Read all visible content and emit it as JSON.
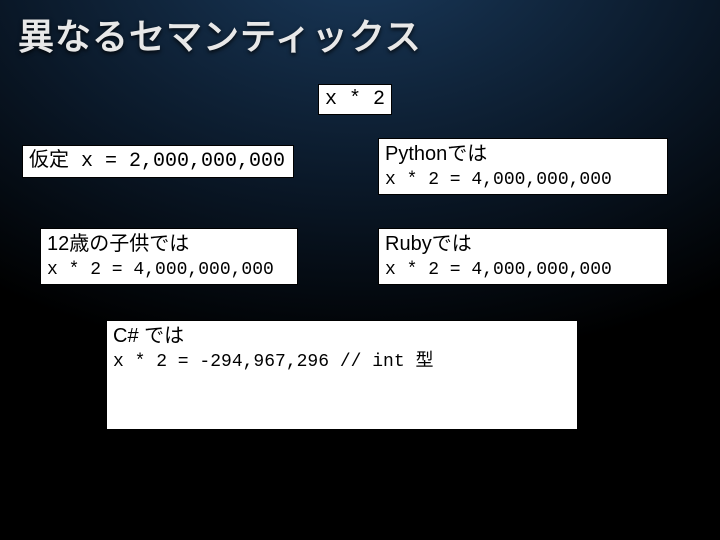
{
  "title": "異なるセマンティックス",
  "expression": "x * 2",
  "assumption": "仮定 x = 2,000,000,000",
  "python": {
    "label": "Pythonでは",
    "result": "x * 2 = 4,000,000,000"
  },
  "child": {
    "label": "12歳の子供では",
    "result": "x * 2 = 4,000,000,000"
  },
  "ruby": {
    "label": "Rubyでは",
    "result": "x * 2 = 4,000,000,000"
  },
  "csharp": {
    "label": "C# では",
    "result": "x * 2 = -294,967,296 // int 型"
  }
}
